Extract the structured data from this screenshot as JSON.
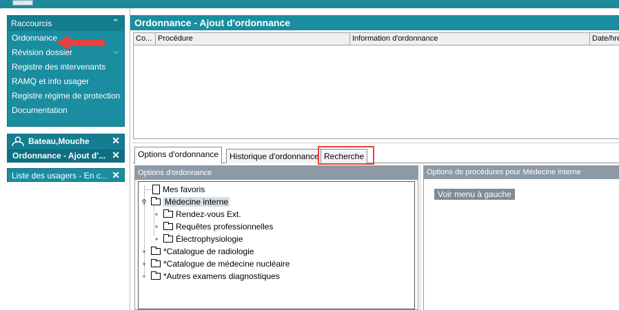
{
  "shortcuts": {
    "title": "Raccourcis",
    "items": [
      {
        "label": "Ordonnance"
      },
      {
        "label": "Révision dossier"
      },
      {
        "label": "Registre des intervenants"
      },
      {
        "label": "RAMQ et info usager"
      },
      {
        "label": "Registre régime de protection"
      },
      {
        "label": "Documentation"
      }
    ]
  },
  "patient": {
    "name": "Bateau,Mouche",
    "context": "Ordonnance - Ajout d'..."
  },
  "user_list": {
    "label": "Liste des usagers - En c..."
  },
  "main": {
    "title": "Ordonnance - Ajout d'ordonnance",
    "columns": [
      "Co...",
      "Procédure",
      "Information d'ordonnance",
      "Date/hre"
    ],
    "tabs": [
      "Options d'ordonnance",
      "Historique d'ordonnance",
      "Recherche"
    ],
    "active_tab": "Options d'ordonnance",
    "highlighted_tab": "Recherche"
  },
  "options_panel": {
    "title": "Options d'ordonnance",
    "tree": [
      {
        "label": "Mes favoris",
        "type": "doc"
      },
      {
        "label": "Médecine interne",
        "type": "folder",
        "expanded": true,
        "selected": true
      },
      {
        "label": "Rendez-vous Ext.",
        "type": "folder"
      },
      {
        "label": "Requêtes professionnelles",
        "type": "folder"
      },
      {
        "label": "Électrophysiologie",
        "type": "folder"
      },
      {
        "label": "*Catalogue de radiologie",
        "type": "folder"
      },
      {
        "label": "*Catalogue de médecine nucléaire",
        "type": "folder"
      },
      {
        "label": "*Autres examens diagnostiques",
        "type": "folder"
      }
    ]
  },
  "procedures_panel": {
    "title": "Options de procédures pour Médecine interne",
    "button_label": "Voir menu à gauche"
  },
  "colors": {
    "teal": "#1a8da0",
    "teal_dark": "#157d90",
    "panel_header_gray": "#8c9aa6",
    "highlight_red": "#e8403a"
  }
}
